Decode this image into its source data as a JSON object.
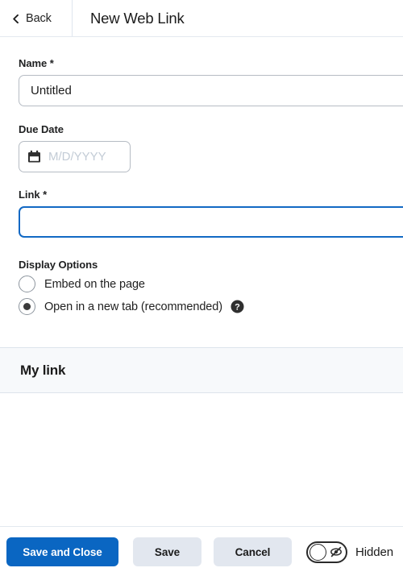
{
  "header": {
    "back_label": "Back",
    "back_icon": "chevron-left-icon",
    "title": "New Web Link"
  },
  "form": {
    "name": {
      "label": "Name",
      "required_marker": "*",
      "value": "Untitled",
      "placeholder": ""
    },
    "due_date": {
      "label": "Due Date",
      "icon": "calendar-icon",
      "value": "",
      "placeholder": "M/D/YYYY"
    },
    "link": {
      "label": "Link",
      "required_marker": "*",
      "value": "",
      "placeholder": ""
    },
    "display_options": {
      "label": "Display Options",
      "options": [
        {
          "label": "Embed on the page",
          "selected": false
        },
        {
          "label": "Open in a new tab (recommended)",
          "selected": true,
          "help_icon": "help-circle-icon"
        }
      ]
    }
  },
  "preview": {
    "title": "My link"
  },
  "footer": {
    "save_and_close_label": "Save and Close",
    "save_label": "Save",
    "cancel_label": "Cancel",
    "visibility": {
      "label": "Hidden",
      "icon": "eye-off-icon",
      "on": false
    }
  },
  "colors": {
    "primary": "#0a66c2",
    "focus_border": "#1269c4",
    "secondary_button": "#e2e7ef",
    "band_background": "#f7f9fb",
    "border": "#b6bcc4"
  }
}
